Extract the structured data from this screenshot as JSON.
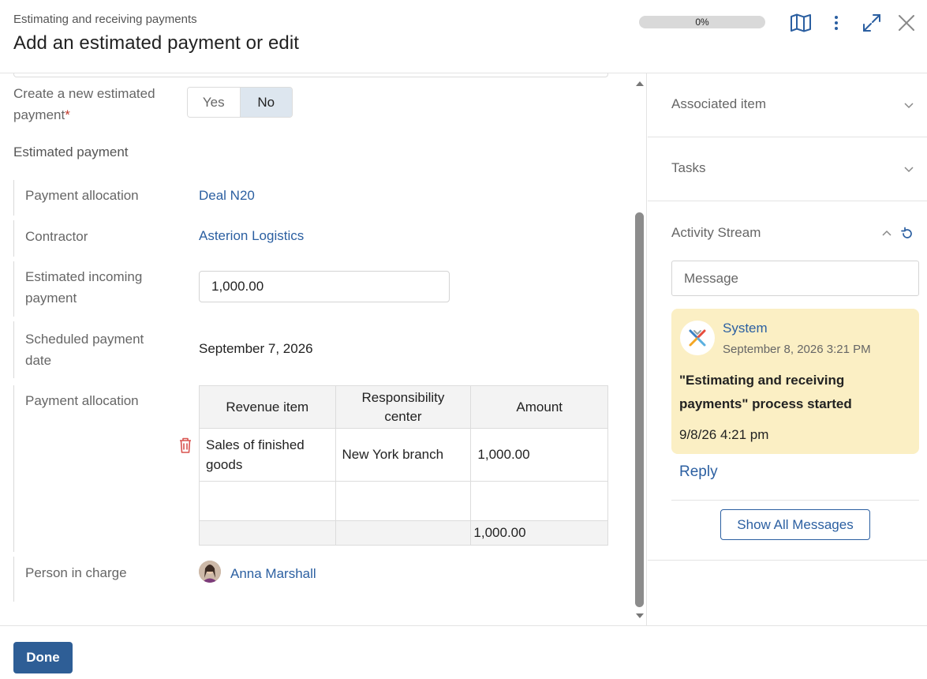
{
  "header": {
    "subtitle": "Estimating and receiving payments",
    "title": "Add an estimated payment or edit",
    "progress_label": "0%",
    "progress_value": 0,
    "icons": [
      "map-icon",
      "more-vertical-icon",
      "expand-icon",
      "close-icon"
    ]
  },
  "form": {
    "create_new_label_line1": "Create a new estimated",
    "create_new_label_line2": "payment",
    "required_mark": "*",
    "toggle_yes": "Yes",
    "toggle_no": "No",
    "toggle_selected": "No",
    "section_title": "Estimated payment",
    "payment_allocation_label": "Payment allocation",
    "payment_allocation_value": "Deal N20",
    "contractor_label": "Contractor",
    "contractor_value": "Asterion Logistics",
    "incoming_label_line1": "Estimated incoming",
    "incoming_label_line2": "payment",
    "incoming_value": "1,000.00",
    "scheduled_label_line1": "Scheduled payment",
    "scheduled_label_line2": "date",
    "scheduled_value": "September 7, 2026",
    "allocation_table_label": "Payment allocation",
    "table": {
      "headers": [
        "Revenue item",
        "Responsibility center",
        "Amount"
      ],
      "rows": [
        {
          "revenue_item": "Sales of finished goods",
          "center": "New York branch",
          "amount": "1,000.00"
        }
      ],
      "total": "1,000.00"
    },
    "person_label": "Person in charge",
    "person_value": "Anna Marshall"
  },
  "sidebar": {
    "associated_item": "Associated item",
    "tasks": "Tasks",
    "activity_stream": "Activity Stream",
    "message_placeholder": "Message",
    "message": {
      "author": "System",
      "date": "September 8, 2026 3:21 PM",
      "text": "\"Estimating and receiving payments\" process started",
      "time": "9/8/26 4:21 pm"
    },
    "reply": "Reply",
    "show_all": "Show All Messages"
  },
  "footer": {
    "done": "Done"
  },
  "colors": {
    "accent": "#2b5fa1",
    "primary_button": "#2e5e96",
    "card_bg": "#fbefc4",
    "toggle_selected_bg": "#dde6ef",
    "required": "#c0392b",
    "trash": "#d9534f"
  }
}
